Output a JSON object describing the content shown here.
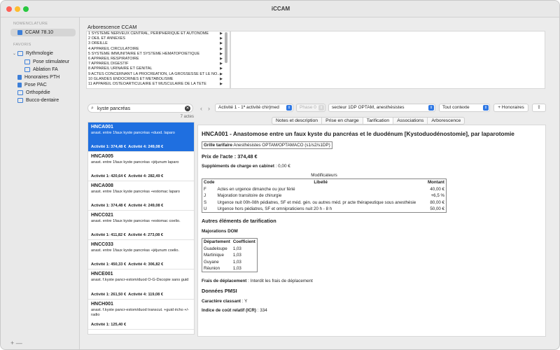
{
  "window": {
    "title": "iCCAM"
  },
  "sidebar": {
    "section_nomenclature": "NOMENCLATURE",
    "nomenclature_item": "CCAM 78.10",
    "section_favoris": "FAVORIS",
    "favoris": [
      {
        "label": "Rythmologie",
        "icon": "folder-icon"
      },
      {
        "label": "Pose stimulateur",
        "icon": "book-icon"
      },
      {
        "label": "Ablation FA",
        "icon": "book-icon"
      },
      {
        "label": "Honoraires PTH",
        "icon": "document-icon"
      },
      {
        "label": "Pose PAC",
        "icon": "document-icon"
      },
      {
        "label": "Orthopédie",
        "icon": "folder-icon"
      },
      {
        "label": "Bucco-dentaire",
        "icon": "folder-icon"
      }
    ],
    "bottom_controls": "+ —"
  },
  "tree": {
    "title": "Arborescence CCAM",
    "items": [
      "1 SYSTÈME NERVEUX CENTRAL, PÉRIPHÉRIQUE ET AUTONOME",
      "2 OEIL ET ANNEXES",
      "3 OREILLE",
      "4 APPAREIL CIRCULATOIRE",
      "5 SYSTÈME IMMUNITAIRE ET SYSTÈME HÉMATOPOÏÉTIQUE",
      "6 APPAREIL RESPIRATOIRE",
      "7 APPAREIL DIGESTIF",
      "8 APPAREIL URINAIRE ET GÉNITAL",
      "9 ACTES CONCERNANT LA PROCRÉATION, LA GROSSESSE ET LE NO...",
      "10 GLANDES ENDOCRINES ET MÉTABOLISME",
      "11 APPAREIL OSTÉOARTICULAIRE ET MUSCULAIRE DE LA TÊTE"
    ]
  },
  "search": {
    "value": "kyste pancréas",
    "count": "7 actes"
  },
  "acts": [
    {
      "code": "HNCA001",
      "label": "anast. entre 1faux kyste pancréas +duod. laparo",
      "p1": "Activité 1: 374,48 €",
      "p4": "Activité 4: 249,08 €"
    },
    {
      "code": "HNCA005",
      "label": "anast. entre 1faux kyste pancréas +jéjunum laparo",
      "p1": "Activité 1: 420,64 €",
      "p4": "Activité 4: 282,49 €"
    },
    {
      "code": "HNCA008",
      "label": "anast. entre 1faux kyste pancréas +estomac laparo",
      "p1": "Activité 1: 374,48 €",
      "p4": "Activité 4: 249,08 €"
    },
    {
      "code": "HNCC021",
      "label": "anast. entre 1faux kyste pancréas +estomac coelio.",
      "p1": "Activité 1: 411,82 €",
      "p4": "Activité 4: 273,08 €"
    },
    {
      "code": "HNCC033",
      "label": "anast. entre 1faux kyste pancréas +jéjunum coelio.",
      "p1": "Activité 1: 450,33 €",
      "p4": "Activité 4: 306,82 €"
    },
    {
      "code": "HNCE001",
      "label": "anast. f.kyste pancr-estom/duod O-G-Dscopie sans guid",
      "p1": "Activité 1: 261,50 €",
      "p4": "Activité 4: 119,08 €"
    },
    {
      "code": "HNCH001",
      "label": "anast. f.kyste pancr-estom/duod transcut. +guid écho +/-radio",
      "p1": "Activité 1: 125,40 €",
      "p4": ""
    }
  ],
  "toolbar": {
    "back": "‹",
    "forward": "›",
    "activite": "Activité 1 - 1ª activité chir|med",
    "phase": "Phase 0",
    "secteur": "secteur 1DP OPTAM, anesthésistes",
    "contexte": "Tout contexte",
    "honoraires": "+ Honoraires",
    "share_icon": "share-icon"
  },
  "tabs": [
    "Notes et description",
    "Prise en charge",
    "Tarification",
    "Associations",
    "Arborescence"
  ],
  "detail": {
    "title": "HNCA001 - Anastomose entre un faux kyste du pancréas et le duodénum [Kystoduodénostomie], par laparotomie",
    "grille_label": "Grille tarifaire",
    "grille_value": "Anesthésistes OPTAM/OPTAMACO (s1/s2/s1DP)",
    "prix_label": "Prix de l'acte : 374,48 €",
    "supplements_label": "Suppléments de charge en cabinet",
    "supplements_value": " : 0,00 €",
    "modificateurs_caption": "Modificateurs",
    "mod_headers": {
      "code": "Code",
      "libelle": "Libellé",
      "montant": "Montant"
    },
    "modificateurs": [
      {
        "code": "F",
        "libelle": "Actes en urgence dimanche ou jour férié",
        "montant": "40,00 €"
      },
      {
        "code": "J",
        "libelle": "Majoration transitoire de chirurgie",
        "montant": "+6,5 %"
      },
      {
        "code": "S",
        "libelle": "Urgence nuit 00h-08h pédiatres, SF et méd. gén. ou autres méd. pr acte thérapeutique sous anesthésie",
        "montant": "80,00 €"
      },
      {
        "code": "U",
        "libelle": "Urgence hors pédiatres, SF et omnipraticiens nuit 20 h - 8 h",
        "montant": "50,00 €"
      }
    ],
    "autres_title": "Autres éléments de tarification",
    "majorations_title": "Majorations DOM",
    "dom_headers": {
      "departement": "Département",
      "coefficient": "Coefficient"
    },
    "dom": [
      {
        "departement": "Guadeloupe",
        "coefficient": "1,03"
      },
      {
        "departement": "Martinique",
        "coefficient": "1,03"
      },
      {
        "departement": "Guyane",
        "coefficient": "1,03"
      },
      {
        "departement": "Réunion",
        "coefficient": "1,03"
      }
    ],
    "frais_label": "Frais de déplacement",
    "frais_value": " : Interdit les frais de déplacement",
    "pmsi_title": "Données PMSI",
    "classant_label": "Caractère classant",
    "classant_value": " : Y",
    "icr_label": "Indice de coût relatif (ICR)",
    "icr_value": " : 334"
  },
  "colors": {
    "accent": "#1f6fe0",
    "selection_text": "#ffffff"
  }
}
